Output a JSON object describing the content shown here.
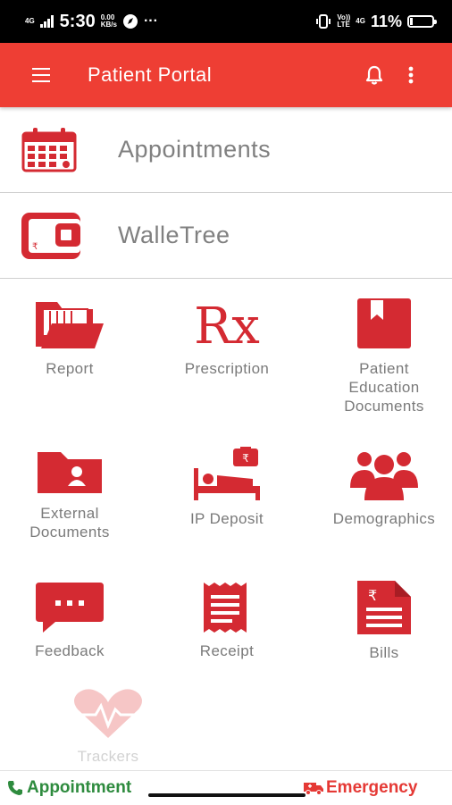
{
  "status_bar": {
    "network": "4G",
    "time": "5:30",
    "speed_value": "0.00",
    "speed_unit": "KB/s",
    "more": "···",
    "volte_top": "Vo))",
    "volte_bottom": "LTE",
    "network2": "4G",
    "battery": "11%",
    "battery_level": 0.11
  },
  "app_bar": {
    "title": "Patient Portal",
    "menu_icon": "hamburger-icon",
    "bell_icon": "bell-icon",
    "more_icon": "more-vertical-icon"
  },
  "features": [
    {
      "label": "Appointments",
      "icon": "calendar-icon"
    },
    {
      "label": "WalleTree",
      "icon": "wallet-icon"
    }
  ],
  "tiles": [
    {
      "label": "Report",
      "icon": "folder-report-icon"
    },
    {
      "label": "Prescription",
      "icon": "rx-icon"
    },
    {
      "label": "Patient Education Documents",
      "icon": "bookmark-book-icon"
    },
    {
      "label": "External Documents",
      "icon": "folder-user-icon"
    },
    {
      "label": "IP Deposit",
      "icon": "bed-deposit-icon"
    },
    {
      "label": "Demographics",
      "icon": "group-icon"
    },
    {
      "label": "Feedback",
      "icon": "chat-icon"
    },
    {
      "label": "Receipt",
      "icon": "receipt-icon"
    },
    {
      "label": "Bills",
      "icon": "bill-icon"
    },
    {
      "label": "Trackers",
      "icon": "heart-pulse-icon"
    }
  ],
  "bottom_bar": {
    "appointment": "Appointment",
    "emergency": "Emergency"
  },
  "colors": {
    "brand": "#ee3e34",
    "icon_red": "#d42a32",
    "appointment_green": "#2e8b3e",
    "emergency_red": "#e53935"
  }
}
